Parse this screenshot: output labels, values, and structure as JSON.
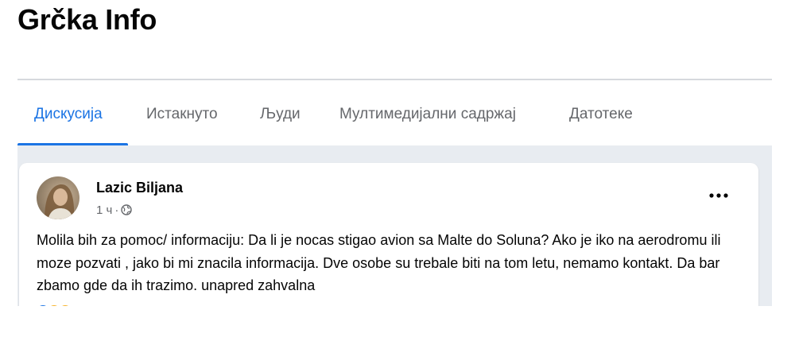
{
  "group": {
    "title": "Grčka Info"
  },
  "tabs": [
    {
      "label": "Дискусија",
      "active": true
    },
    {
      "label": "Истакнуто",
      "active": false
    },
    {
      "label": "Људи",
      "active": false
    },
    {
      "label": "Мултимедијални садржај",
      "active": false
    },
    {
      "label": "Датотеке",
      "active": false
    }
  ],
  "post": {
    "author": "Lazic Biljana",
    "time": "1 ч",
    "separator": "·",
    "privacy_icon": "globe-icon",
    "more_icon": "more-options-icon",
    "text": "Molila bih za pomoc/ informaciju: Da li je nocas stigao avion sa Malte do Soluna? Ako je iko na aerodromu ili moze pozvati , jako bi mi znacila informacija. Dve osobe su trebale biti na tom letu, nemamo kontakt. Da bar zbamo gde da ih trazimo. unapred zahvalna"
  },
  "colors": {
    "accent": "#1b74e4",
    "feed_background": "#e8ecf1",
    "secondary_text": "#65676b",
    "primary_text": "#050505"
  }
}
